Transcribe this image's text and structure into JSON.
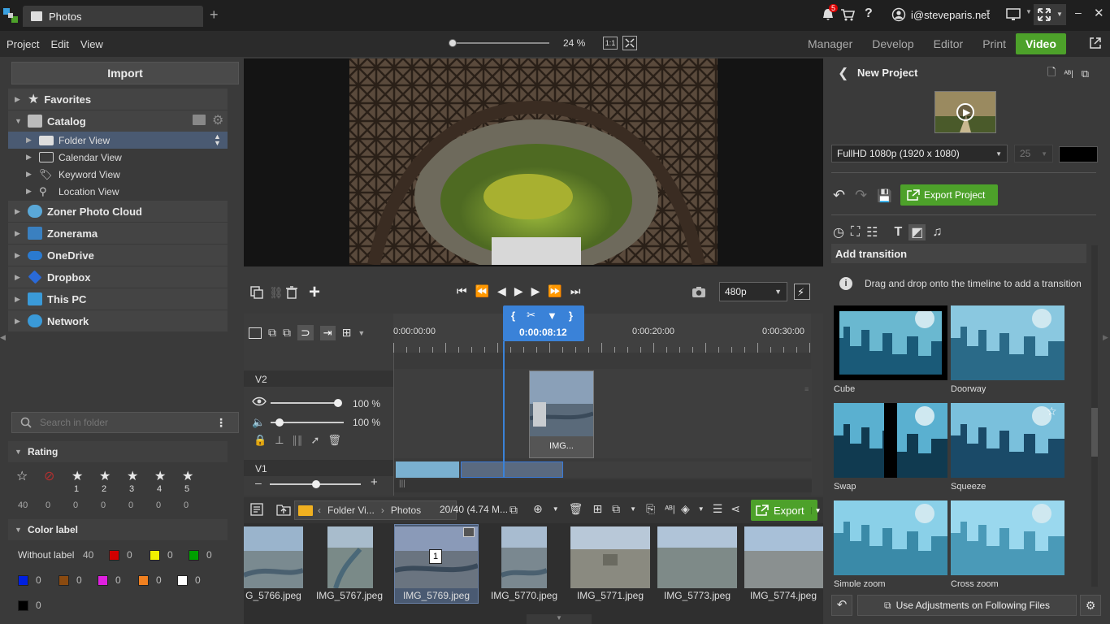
{
  "app": {
    "title": "Photos"
  },
  "topbar": {
    "notification_count": "5",
    "user_email": "i@steveparis.net"
  },
  "menu": {
    "items": [
      "Project",
      "Edit",
      "View"
    ]
  },
  "zoom": {
    "value": "24 %",
    "one_to_one": "1:1"
  },
  "modes": {
    "items": [
      "Manager",
      "Develop",
      "Editor",
      "Print",
      "Video"
    ],
    "active": "Video"
  },
  "left": {
    "import_label": "Import",
    "favorites": "Favorites",
    "catalog": "Catalog",
    "catalog_items": [
      "Folder View",
      "Calendar View",
      "Keyword View",
      "Location View"
    ],
    "sources": [
      "Zoner Photo Cloud",
      "Zonerama",
      "OneDrive",
      "Dropbox",
      "This PC",
      "Network"
    ],
    "search_placeholder": "Search in folder",
    "rating_title": "Rating",
    "rating_labels": [
      "",
      "",
      "1",
      "2",
      "3",
      "4",
      "5"
    ],
    "rating_counts": [
      "40",
      "0",
      "0",
      "0",
      "0",
      "0",
      "0"
    ],
    "color_title": "Color label",
    "without_label": "Without label",
    "without_label_count": "40",
    "color_labels": [
      {
        "color": "#d00000",
        "count": "0"
      },
      {
        "color": "#f0f000",
        "count": "0"
      },
      {
        "color": "#00a000",
        "count": "0"
      },
      {
        "color": "#0020e0",
        "count": "0"
      },
      {
        "color": "#8a4a10",
        "count": "0"
      },
      {
        "color": "#e020e0",
        "count": "0"
      },
      {
        "color": "#f08020",
        "count": "0"
      },
      {
        "color": "#ffffff",
        "count": "0"
      },
      {
        "color": "#000000",
        "count": "0"
      }
    ]
  },
  "transport": {
    "resolution": "480p"
  },
  "timeline": {
    "playhead_time": "0:00:08:12",
    "ticks": [
      "0:00:00:00",
      "0:00:20:00",
      "0:00:30:00"
    ],
    "v2_label": "V2",
    "v1_label": "V1",
    "opacity": "100 %",
    "volume": "100 %",
    "clip_label": "IMG..."
  },
  "browser": {
    "breadcrumb_1": "Folder Vi...",
    "breadcrumb_2": "Photos",
    "count": "20/40 (4.74 M...",
    "export_label": "Export",
    "files": [
      "G_5766.jpeg",
      "IMG_5767.jpeg",
      "IMG_5769.jpeg",
      "IMG_5770.jpeg",
      "IMG_5771.jpeg",
      "IMG_5773.jpeg",
      "IMG_5774.jpeg"
    ],
    "selected_badge": "1"
  },
  "right": {
    "project_title": "New Project",
    "format": "FullHD 1080p (1920 x 1080)",
    "fps": "25",
    "export_project": "Export Project",
    "section_title": "Add transition",
    "info": "Drag and drop onto the timeline to add a transition",
    "transitions": [
      "Cube",
      "Doorway",
      "Swap",
      "Squeeze",
      "Simple zoom",
      "Cross zoom"
    ],
    "use_adjustments": "Use Adjustments on Following Files"
  }
}
